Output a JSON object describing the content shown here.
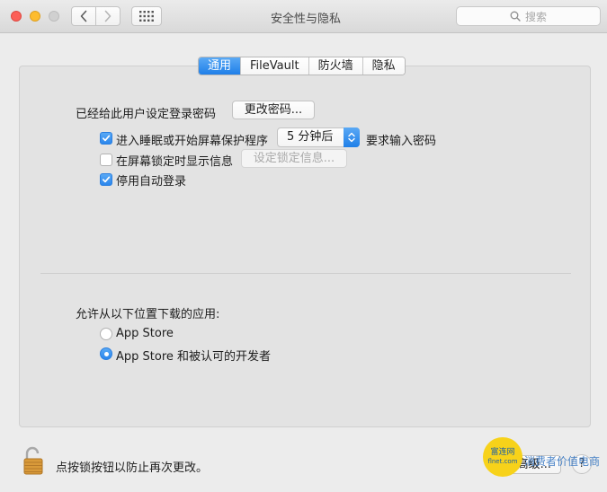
{
  "window": {
    "title": "安全性与隐私"
  },
  "toolbar": {
    "search_placeholder": "搜索"
  },
  "tabs": [
    {
      "label": "通用",
      "active": true
    },
    {
      "label": "FileVault",
      "active": false
    },
    {
      "label": "防火墙",
      "active": false
    },
    {
      "label": "隐私",
      "active": false
    }
  ],
  "general": {
    "password_label": "已经给此用户设定登录密码",
    "change_password_button": "更改密码...",
    "sleep_checkbox": {
      "label": "进入睡眠或开始屏幕保护程序",
      "checked": true
    },
    "sleep_delay_select": "5 分钟后",
    "require_password_label": "要求输入密码",
    "lock_message_checkbox": {
      "label": "在屏幕锁定时显示信息",
      "checked": false
    },
    "set_lock_message_button": "设定锁定信息...",
    "disable_autologin_checkbox": {
      "label": "停用自动登录",
      "checked": true
    }
  },
  "downloads": {
    "heading": "允许从以下位置下载的应用:",
    "options": [
      {
        "label": "App Store",
        "selected": false
      },
      {
        "label": "App Store 和被认可的开发者",
        "selected": true
      }
    ]
  },
  "footer": {
    "lock_text": "点按锁按钮以防止再次更改。",
    "advanced_button": "高级...",
    "help_button": "?"
  },
  "watermark": {
    "logo_line1": "富连网",
    "logo_line2": "flnet.com",
    "text": "消费者价值电商"
  },
  "colors": {
    "accent": "#1f7fe8",
    "close": "#fc5f57",
    "minimize": "#fdbc2e",
    "zoom_disabled": "#d0d0d0"
  }
}
